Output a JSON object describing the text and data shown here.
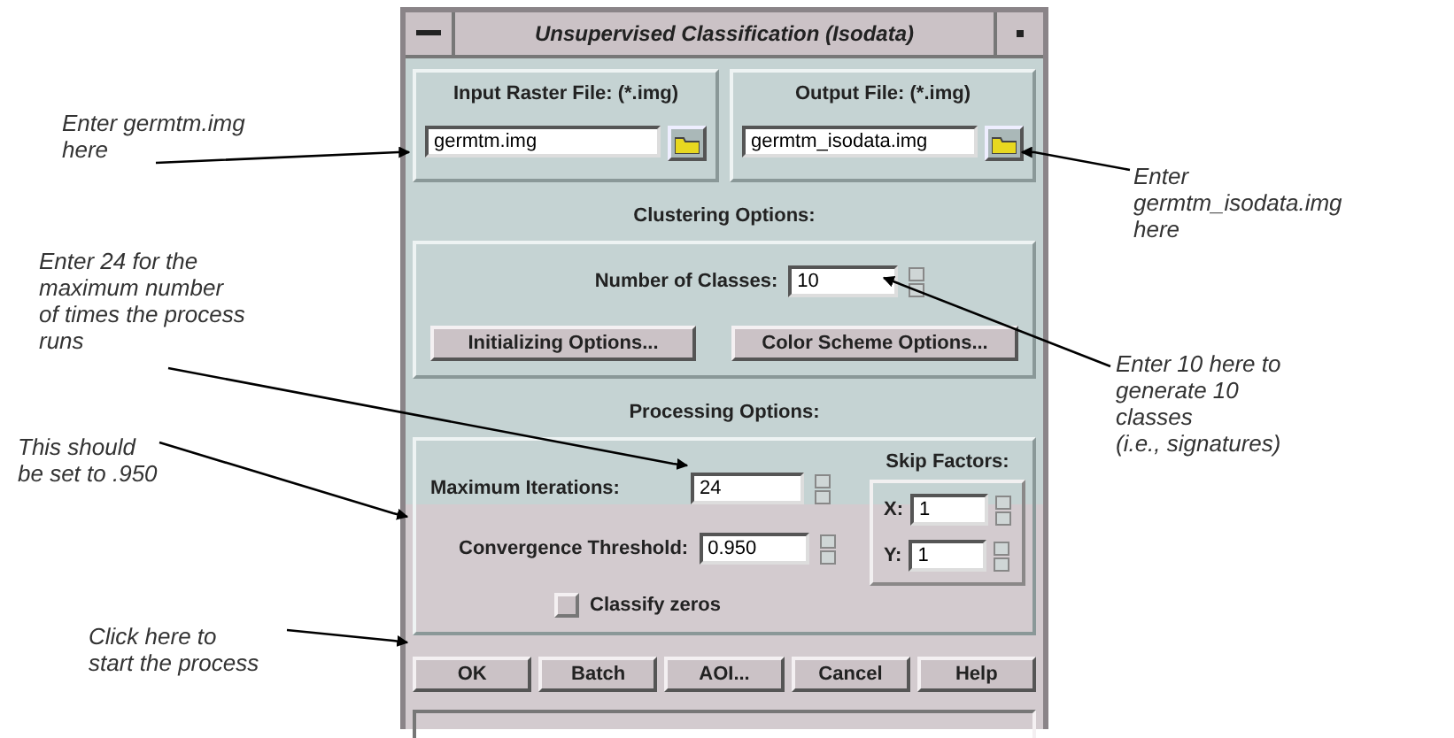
{
  "window": {
    "title": "Unsupervised Classification (Isodata)"
  },
  "input_file": {
    "label": "Input Raster File: (*.img)",
    "value": "germtm.img"
  },
  "output_file": {
    "label": "Output File: (*.img)",
    "value": "germtm_isodata.img"
  },
  "clustering": {
    "heading": "Clustering Options:",
    "classes_label": "Number of Classes:",
    "classes_value": "10",
    "buttons": [
      "Initializing Options...",
      "Color Scheme Options..."
    ]
  },
  "processing": {
    "heading": "Processing Options:",
    "iterations_label": "Maximum Iterations:",
    "iterations_value": "24",
    "threshold_label": "Convergence Threshold:",
    "threshold_value": "0.950",
    "classify_zeros": {
      "label": "Classify zeros",
      "checked": false
    },
    "skip": {
      "heading": "Skip Factors:",
      "fields": [
        {
          "label": "X:",
          "value": "1"
        },
        {
          "label": "Y:",
          "value": "1"
        }
      ]
    }
  },
  "buttons": [
    "OK",
    "Batch",
    "AOI...",
    "Cancel",
    "Help"
  ],
  "annotations": [
    {
      "lines": [
        "Enter germtm.img",
        "here"
      ]
    },
    {
      "lines": [
        "Enter 24 for the",
        "maximum number",
        "of times the process",
        "runs"
      ]
    },
    {
      "lines": [
        "This should",
        "be set to .950"
      ]
    },
    {
      "lines": [
        "Click here to",
        "start the process"
      ]
    },
    {
      "lines": [
        "Enter",
        "germtm_isodata.img",
        "here"
      ]
    },
    {
      "lines": [
        "Enter 10 here to",
        "generate 10",
        "classes",
        "(i.e., signatures)"
      ]
    }
  ]
}
